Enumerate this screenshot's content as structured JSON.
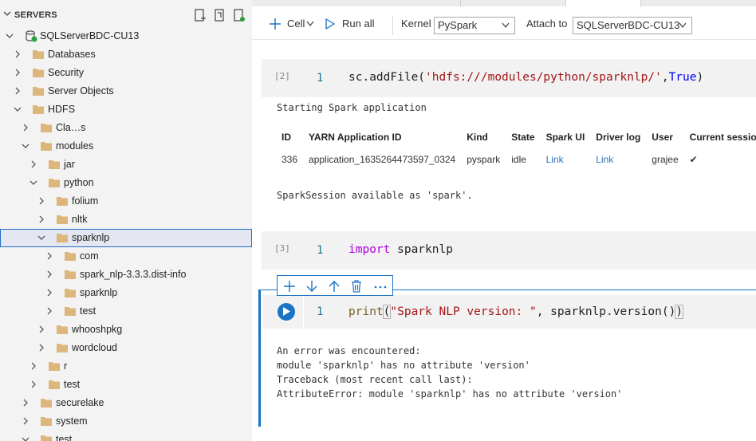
{
  "tree": {
    "header": "SERVERS",
    "server": "SQLServerBDC-CU13",
    "items": [
      {
        "label": "Databases"
      },
      {
        "label": "Security"
      },
      {
        "label": "Server Objects"
      },
      {
        "label": "HDFS"
      },
      {
        "label": "Cla…s"
      },
      {
        "label": "modules"
      },
      {
        "label": "jar"
      },
      {
        "label": "python"
      },
      {
        "label": "folium"
      },
      {
        "label": "nltk"
      },
      {
        "label": "sparknlp"
      },
      {
        "label": "com"
      },
      {
        "label": "spark_nlp-3.3.3.dist-info"
      },
      {
        "label": "sparknlp"
      },
      {
        "label": "test"
      },
      {
        "label": "whooshpkg"
      },
      {
        "label": "wordcloud"
      },
      {
        "label": "r"
      },
      {
        "label": "test"
      },
      {
        "label": "securelake"
      },
      {
        "label": "system"
      },
      {
        "label": "test"
      }
    ]
  },
  "toolbar": {
    "cell_label": "Cell",
    "run_all_label": "Run all",
    "kernel_label": "Kernel",
    "kernel_value": "PySpark",
    "attach_label": "Attach to",
    "attach_value": "SQLServerBDC-CU13"
  },
  "cells": [
    {
      "exec_count": "[2]",
      "line_number": "1",
      "code": {
        "fn": "sc.addFile(",
        "str": "'hdfs:///modules/python/sparknlp/'",
        "sep": ",",
        "bool": "True",
        "end": ")"
      },
      "output_start": "Starting Spark application",
      "table": {
        "headers": [
          "ID",
          "YARN Application ID",
          "Kind",
          "State",
          "Spark UI",
          "Driver log",
          "User",
          "Current session?"
        ],
        "row": [
          "336",
          "application_1635264473597_0324",
          "pyspark",
          "idle",
          "Link",
          "Link",
          "grajee",
          "✔"
        ]
      },
      "output_end": "SparkSession available as 'spark'."
    },
    {
      "exec_count": "[3]",
      "line_number": "1",
      "code": {
        "kw": "import",
        "rest": " sparknlp"
      }
    },
    {
      "line_number": "1",
      "code": {
        "fn": "print",
        "open": "(",
        "str": "\"Spark NLP version: \"",
        "rest": ", sparknlp.version()",
        "close": ")"
      },
      "error_lines": [
        "An error was encountered:",
        "module 'sparknlp' has no attribute 'version'",
        "Traceback (most recent call last):",
        "AttributeError: module 'sparknlp' has no attribute 'version'"
      ]
    }
  ],
  "colors": {
    "accent": "#1a73c4",
    "folder": "#dcb67a",
    "link": "#2f6fb8"
  }
}
